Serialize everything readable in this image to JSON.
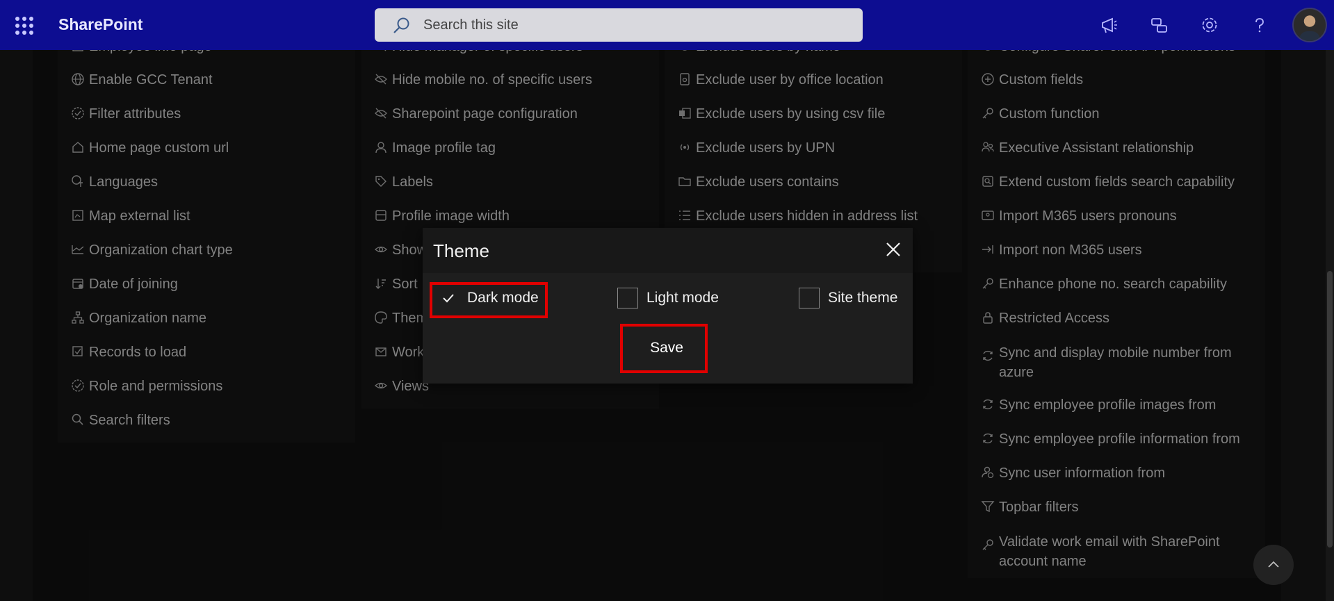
{
  "app": {
    "brand": "SharePoint"
  },
  "search": {
    "placeholder": "Search this site"
  },
  "column1": [
    "Employee info page",
    "Enable GCC Tenant",
    "Filter attributes",
    "Home page custom url",
    "Languages",
    "Map external list",
    "Organization chart type",
    "Date of joining",
    "Organization name",
    "Records to load",
    "Role and permissions",
    "Search filters"
  ],
  "column2": [
    "Hide manager of specific users",
    "Hide mobile no. of specific users",
    "Sharepoint page configuration",
    "Image profile tag",
    "Labels",
    "Profile image width",
    "Show",
    "Sort",
    "Them",
    "Work",
    "Views"
  ],
  "column3": [
    "Exclude users by name",
    "Exclude user by office location",
    "Exclude users by using csv file",
    "Exclude users by UPN",
    "Exclude users contains",
    "Exclude users hidden in address list"
  ],
  "column4": [
    "Configure SharePoint API permissions",
    "Custom fields",
    "Custom function",
    "Executive Assistant relationship",
    "Extend custom fields search capability",
    "Import M365 users pronouns",
    "Import non M365 users",
    "Enhance phone no. search capability",
    "Restricted Access",
    "Sync and display mobile number from azure",
    "Sync employee profile images from",
    "Sync employee profile information from",
    "Sync user information from",
    "Topbar filters",
    "Validate work email with SharePoint account name"
  ],
  "dialog": {
    "title": "Theme",
    "options": [
      "Dark mode",
      "Light mode",
      "Site theme"
    ],
    "selected": "Dark mode",
    "save_label": "Save"
  },
  "colors": {
    "suitebar": "#0d0d91",
    "highlight": "#e00000"
  }
}
